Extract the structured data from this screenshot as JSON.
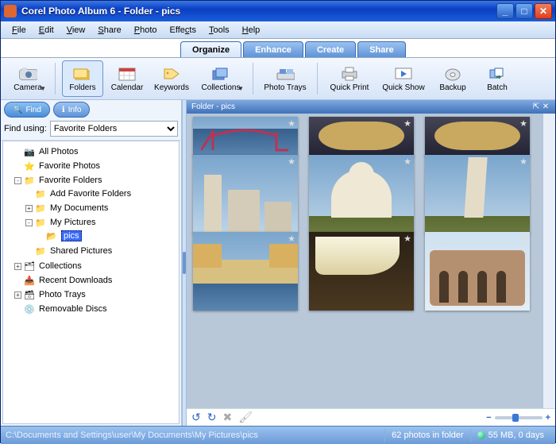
{
  "window": {
    "title": "Corel Photo Album 6 - Folder - pics"
  },
  "menu": {
    "items": [
      "File",
      "Edit",
      "View",
      "Share",
      "Photo",
      "Effects",
      "Tools",
      "Help"
    ]
  },
  "modes": {
    "tabs": [
      "Organize",
      "Enhance",
      "Create",
      "Share"
    ],
    "active": 0
  },
  "toolbar": {
    "camera": "Camera",
    "folders": "Folders",
    "calendar": "Calendar",
    "keywords": "Keywords",
    "collections": "Collections",
    "phototrays": "Photo Trays",
    "quickprint": "Quick Print",
    "quickshow": "Quick Show",
    "backup": "Backup",
    "batch": "Batch"
  },
  "left": {
    "find_label": "Find",
    "info_label": "Info",
    "find_using_label": "Find using:",
    "find_select": "Favorite Folders",
    "tree": {
      "all_photos": "All Photos",
      "favorite_photos": "Favorite Photos",
      "favorite_folders": "Favorite Folders",
      "add_favorite": "Add Favorite Folders",
      "my_documents": "My Documents",
      "my_pictures": "My Pictures",
      "pics": "pics",
      "shared_pictures": "Shared Pictures",
      "collections": "Collections",
      "recent_downloads": "Recent Downloads",
      "photo_trays": "Photo Trays",
      "removable_discs": "Removable Discs"
    }
  },
  "right": {
    "panel_title": "Folder - pics"
  },
  "status": {
    "path": "C:\\Documents and Settings\\user\\My Documents\\My Pictures\\pics",
    "count": "62 photos in folder",
    "disk": "55 MB, 0 days"
  },
  "zoom": {
    "minus": "−",
    "plus": "+"
  }
}
